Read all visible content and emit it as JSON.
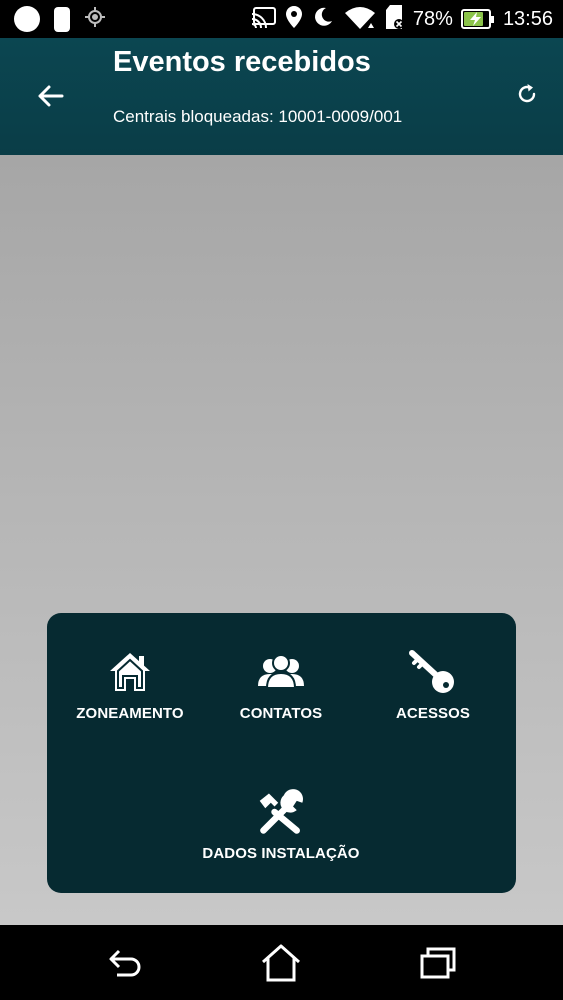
{
  "status_bar": {
    "battery_percent": "78%",
    "time": "13:56",
    "battery_level": 0.78,
    "battery_color": "#8bc34a",
    "icons": [
      "notification-dot-icon",
      "notification-card-icon",
      "gps-icon",
      "cast-icon",
      "location-pin-icon",
      "do-not-disturb-moon-icon",
      "wifi-icon",
      "sd-card-icon",
      "battery-charging-icon"
    ]
  },
  "app_bar": {
    "title": "Eventos recebidos",
    "subtitle": "Centrais bloqueadas: 10001-0009/001",
    "background": "#0a4350"
  },
  "menu": {
    "background": "#062a31",
    "items": [
      {
        "label": "ZONEAMENTO",
        "icon": "home-icon"
      },
      {
        "label": "CONTATOS",
        "icon": "contacts-group-icon"
      },
      {
        "label": "ACESSOS",
        "icon": "key-icon"
      },
      {
        "label": "DADOS INSTALAÇÃO",
        "icon": "tools-hammer-wrench-icon"
      }
    ]
  },
  "nav_bar": {
    "buttons": [
      "back-icon",
      "home-icon",
      "recent-apps-icon"
    ]
  }
}
